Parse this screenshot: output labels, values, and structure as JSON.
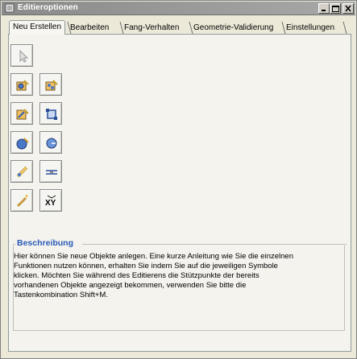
{
  "window": {
    "title": "Editieroptionen",
    "controls": [
      "minimize-icon",
      "maximize-icon",
      "close-icon"
    ]
  },
  "tabs": [
    {
      "label": "Neu Erstellen",
      "active": true
    },
    {
      "label": "Bearbeiten",
      "active": false
    },
    {
      "label": "Fang-Verhalten",
      "active": false
    },
    {
      "label": "Geometrie-Validierung",
      "active": false
    },
    {
      "label": "Einstellungen",
      "active": false
    }
  ],
  "tools": [
    {
      "icon": "select-pointer-icon"
    },
    {
      "icon": "new-point-object-icon"
    },
    {
      "icon": "new-point-object-alt-icon"
    },
    {
      "icon": "new-line-object-icon"
    },
    {
      "icon": "rectangle-icon"
    },
    {
      "icon": "new-polygon-object-icon"
    },
    {
      "icon": "circle-icon"
    },
    {
      "icon": "edit-line-icon"
    },
    {
      "icon": "parallel-line-icon"
    },
    {
      "icon": "wand-icon"
    },
    {
      "icon": "xy-coordinates-icon",
      "label": "XY"
    }
  ],
  "description": {
    "legend": "Beschreibung",
    "lines": [
      "Hier können Sie neue Objekte anlegen. Eine kurze Anleitung wie Sie die einzelnen",
      "Funktionen nutzen können, erhalten Sie indem Sie auf die jeweiligen Symbole",
      "klicken. Möchten Sie während des Editierens die Stützpunkte der bereits",
      "vorhandenen Objekte angezeigt bekommen, verwenden Sie bitte die",
      "Tastenkombination Shift+M."
    ]
  },
  "colors": {
    "titlebar": "#9a9a9a",
    "legend": "#2a5bb8",
    "panel": "#f4f3ee"
  }
}
